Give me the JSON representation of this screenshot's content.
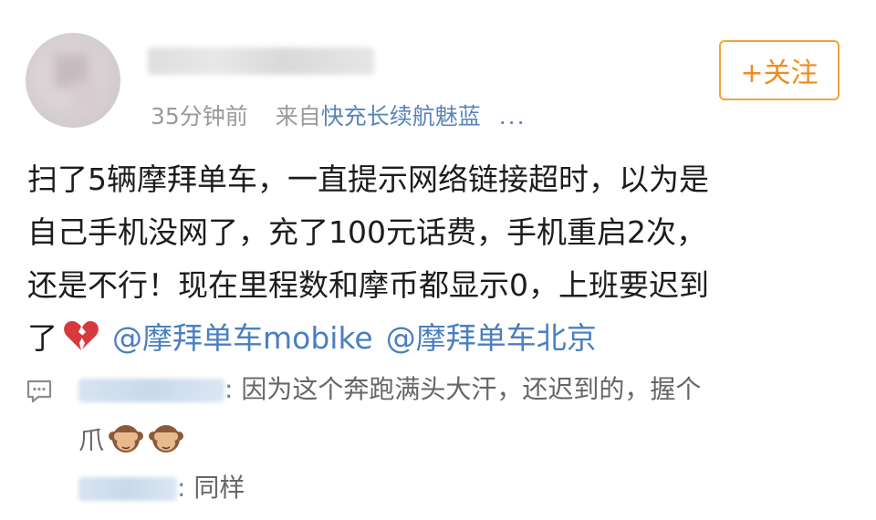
{
  "header": {
    "time_ago": "35分钟前",
    "source_prefix": "来自",
    "source_device": "快充长续航魅蓝",
    "more": "...",
    "follow_label": "+关注"
  },
  "post": {
    "line1": "扫了5辆摩拜单车，一直提示网络链接超时，以为是",
    "line2": "自己手机没网了，充了100元话费，手机重启2次，",
    "line3": "还是不行！现在里程数和摩币都显示0，上班要迟到",
    "line4_prefix": "了",
    "mention1": "@摩拜单车mobike",
    "mention2": "@摩拜单车北京"
  },
  "replies": [
    {
      "colon": ":",
      "text": " 因为这个奔跑满头大汗，还迟到的，握个",
      "text_cont": "爪"
    },
    {
      "colon": ":",
      "text": " 同样"
    }
  ],
  "colors": {
    "accent_orange": "#f08c1c",
    "link_blue": "#4b7fc0",
    "meta_gray": "#9a9a9a"
  },
  "icons": {
    "heart": "broken-heart-icon",
    "comment": "comment-icon",
    "monkey": "see-no-evil-monkey-icon"
  }
}
